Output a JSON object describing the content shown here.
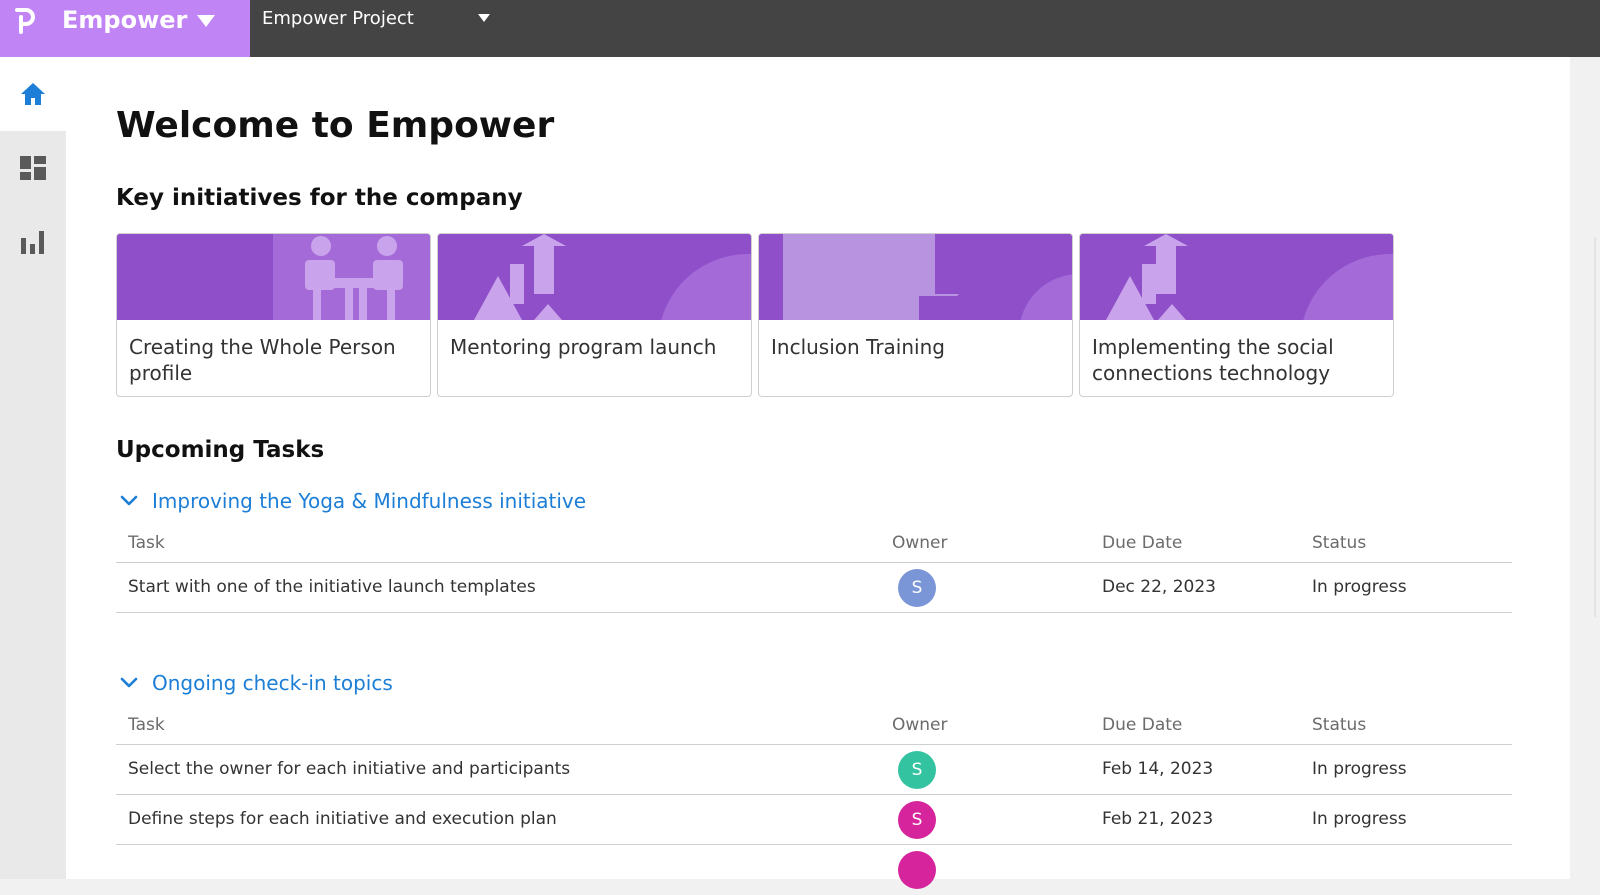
{
  "app": {
    "brand_name": "Empower",
    "project_name": "Empower Project",
    "brand_color": "#c084f5",
    "topbar_color": "#444444"
  },
  "sidebar": {
    "items": [
      {
        "icon": "home-icon",
        "active": true
      },
      {
        "icon": "dashboard-icon",
        "active": false
      },
      {
        "icon": "bar-chart-icon",
        "active": false
      }
    ],
    "active_color": "#1c7ed6"
  },
  "main": {
    "title": "Welcome to Empower",
    "initiatives_title": "Key initiatives for the company",
    "initiatives": [
      {
        "label": "Creating the Whole Person profile",
        "banner_icon": "people-table-icon"
      },
      {
        "label": "Mentoring program launch",
        "banner_icon": "arrows-up-icon"
      },
      {
        "label": "Inclusion Training",
        "banner_icon": "speech-bubble-icon"
      },
      {
        "label": "Implementing the social connections technology",
        "banner_icon": "arrows-up-icon"
      }
    ],
    "tasks_title": "Upcoming Tasks",
    "groups": [
      {
        "title": "Improving the Yoga & Mindfulness initiative",
        "columns": {
          "task": "Task",
          "owner": "Owner",
          "due": "Due Date",
          "status": "Status"
        },
        "rows": [
          {
            "task": "Start with one of the initiative launch templates",
            "owner_initial": "S",
            "owner_color": "#7b96d6",
            "due": "Dec 22, 2023",
            "status": "In progress"
          }
        ]
      },
      {
        "title": "Ongoing check-in topics",
        "columns": {
          "task": "Task",
          "owner": "Owner",
          "due": "Due Date",
          "status": "Status"
        },
        "rows": [
          {
            "task": "Select the owner for each initiative and participants",
            "owner_initial": "S",
            "owner_color": "#33c3a0",
            "due": "Feb 14, 2023",
            "status": "In progress"
          },
          {
            "task": "Define steps for each initiative and execution plan",
            "owner_initial": "S",
            "owner_color": "#d6259c",
            "due": "Feb 21, 2023",
            "status": "In progress"
          }
        ]
      }
    ],
    "link_color": "#1c7ed6",
    "card_color": "#8e4fc9"
  }
}
